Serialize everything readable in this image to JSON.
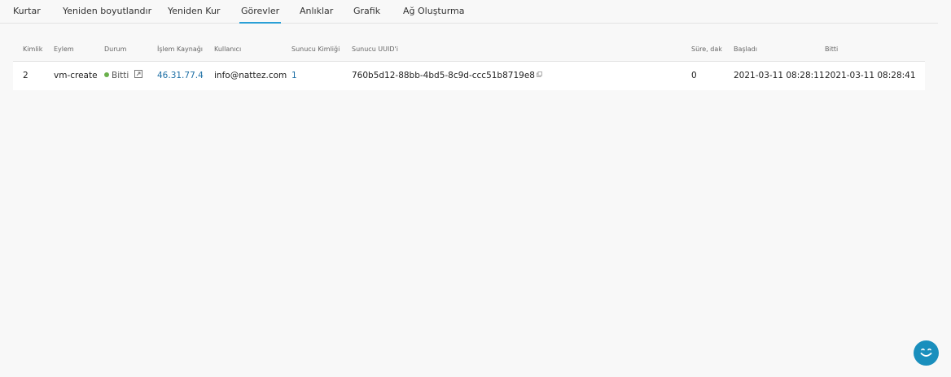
{
  "tabs": [
    {
      "label": "Kurtar"
    },
    {
      "label": "Yeniden boyutlandır"
    },
    {
      "label": "Yeniden Kur"
    },
    {
      "label": "Görevler",
      "active": true
    },
    {
      "label": "Anlıklar"
    },
    {
      "label": "Grafik"
    },
    {
      "label": "Ağ Oluşturma"
    }
  ],
  "table": {
    "headers": {
      "id": "Kimlik",
      "action": "Eylem",
      "status": "Durum",
      "source": "İşlem Kaynağı",
      "user": "Kullanıcı",
      "server_id": "Sunucu Kimliği",
      "server_uuid": "Sunucu UUID'i",
      "duration": "Süre, dak",
      "started": "Başladı",
      "finished": "Bitti"
    },
    "rows": [
      {
        "id": "2",
        "action": "vm-create",
        "status": "Bitti",
        "source": "46.31.77.4",
        "user": "info@nattez.com",
        "server_id": "1",
        "server_uuid": "760b5d12-88bb-4bd5-8c9d-ccc51b8719e8",
        "duration": "0",
        "started": "2021-03-11 08:28:11",
        "finished": "2021-03-11 08:28:41"
      }
    ]
  },
  "colors": {
    "accent": "#2a9fd6",
    "link": "#1d6fa5",
    "status_done": "#6ab04c",
    "chat_button": "#1a8fbd"
  },
  "icons": {
    "status": "dot-icon",
    "expand": "expand-icon",
    "copy": "copy-icon",
    "chat": "chat-smile-icon"
  }
}
